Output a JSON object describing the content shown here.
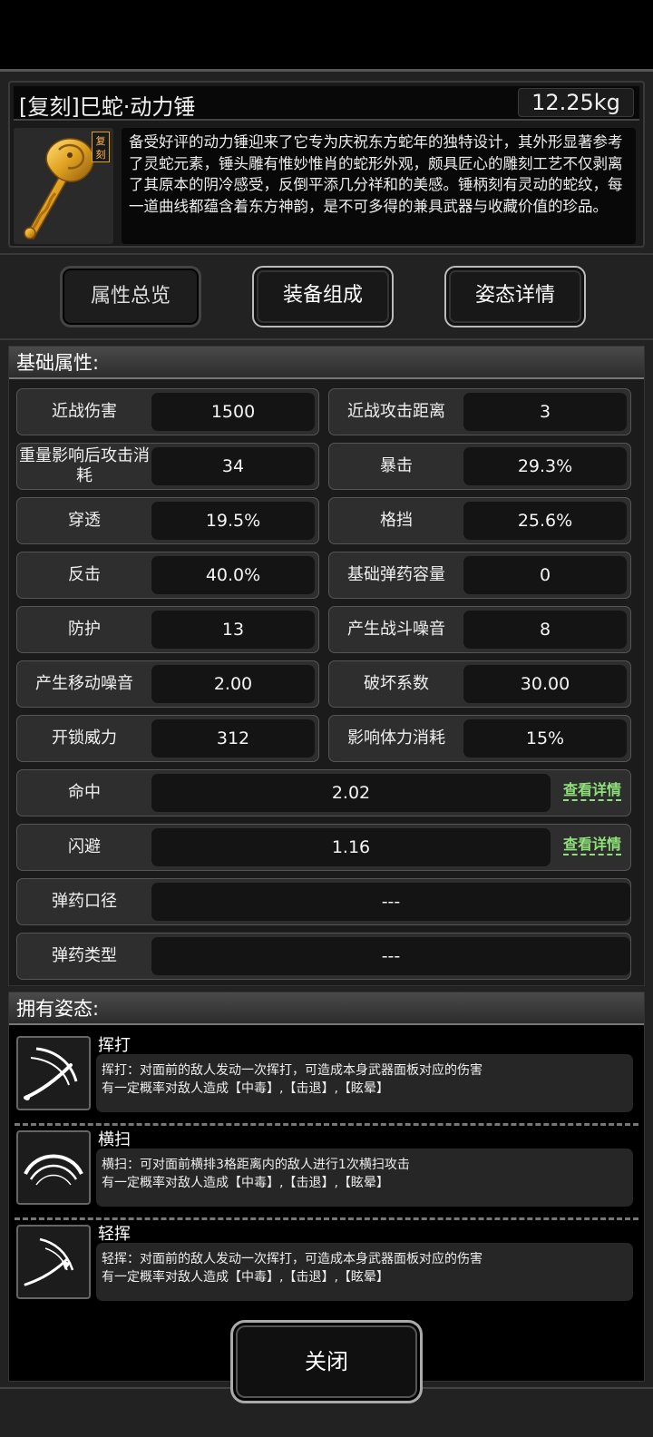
{
  "item": {
    "name": "[复刻]巳蛇·动力锤",
    "weight": "12.25kg",
    "badge": "复刻",
    "description": "备受好评的动力锤迎来了它专为庆祝东方蛇年的独特设计，其外形显著参考了灵蛇元素，锤头雕有惟妙惟肖的蛇形外观，颇具匠心的雕刻工艺不仅剥离了其原本的阴冷感受，反倒平添几分祥和的美感。锤柄刻有灵动的蛇纹，每一道曲线都蕴含着东方神韵，是不可多得的兼具武器与收藏价值的珍品。"
  },
  "tabs": [
    "属性总览",
    "装备组成",
    "姿态详情"
  ],
  "attributes": {
    "header": "基础属性:",
    "pairs": [
      [
        {
          "label": "近战伤害",
          "value": "1500"
        },
        {
          "label": "近战攻击距离",
          "value": "3"
        }
      ],
      [
        {
          "label": "重量影响后攻击消耗",
          "value": "34"
        },
        {
          "label": "暴击",
          "value": "29.3%"
        }
      ],
      [
        {
          "label": "穿透",
          "value": "19.5%"
        },
        {
          "label": "格挡",
          "value": "25.6%"
        }
      ],
      [
        {
          "label": "反击",
          "value": "40.0%"
        },
        {
          "label": "基础弹药容量",
          "value": "0"
        }
      ],
      [
        {
          "label": "防护",
          "value": "13"
        },
        {
          "label": "产生战斗噪音",
          "value": "8"
        }
      ],
      [
        {
          "label": "产生移动噪音",
          "value": "2.00"
        },
        {
          "label": "破坏系数",
          "value": "30.00"
        }
      ],
      [
        {
          "label": "开锁威力",
          "value": "312"
        },
        {
          "label": "影响体力消耗",
          "value": "15%"
        }
      ]
    ],
    "wide": [
      {
        "label": "命中",
        "value": "2.02",
        "link": "查看详情"
      },
      {
        "label": "闪避",
        "value": "1.16",
        "link": "查看详情"
      },
      {
        "label": "弹药口径",
        "value": "---"
      },
      {
        "label": "弹药类型",
        "value": "---"
      }
    ]
  },
  "stances": {
    "header": "拥有姿态:",
    "items": [
      {
        "name": "挥打",
        "line1": "挥打：对面前的敌人发动一次挥打，可造成本身武器面板对应的伤害",
        "line2": "有一定概率对敌人造成【中毒】,【击退】,【眩晕】"
      },
      {
        "name": "横扫",
        "line1": "横扫：可对面前横排3格距离内的敌人进行1次横扫攻击",
        "line2": "有一定概率对敌人造成【中毒】,【击退】,【眩晕】"
      },
      {
        "name": "轻挥",
        "line1": "轻挥：对面前的敌人发动一次挥打，可造成本身武器面板对应的伤害",
        "line2": "有一定概率对敌人造成【中毒】,【击退】,【眩晕】"
      }
    ]
  },
  "close_label": "关闭"
}
